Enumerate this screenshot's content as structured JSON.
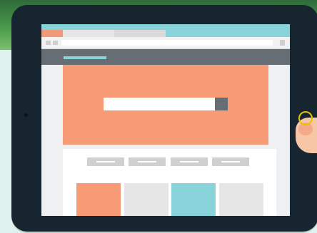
{
  "scene": {
    "device": "tablet",
    "colors": {
      "bezel": "#16252f",
      "accent_coral": "#f79a76",
      "accent_teal": "#89d4db",
      "nav_gray": "#676d74",
      "tile_gray": "#e6e6e6"
    }
  },
  "browser": {
    "tabs": [
      {
        "state": "active",
        "color": "#f19a7b"
      },
      {
        "state": "inactive",
        "color": "#e6e6e6"
      },
      {
        "state": "inactive",
        "color": "#d9d9d9"
      }
    ],
    "address_value": ""
  },
  "website": {
    "hero_search": {
      "value": "",
      "button_icon": "search-icon"
    },
    "menu_buttons": [
      "",
      "",
      "",
      ""
    ],
    "tiles": [
      {
        "color": "#f79a76"
      },
      {
        "color": "#e6e6e6"
      },
      {
        "color": "#89d4db"
      },
      {
        "color": "#e6e6e6"
      }
    ]
  }
}
